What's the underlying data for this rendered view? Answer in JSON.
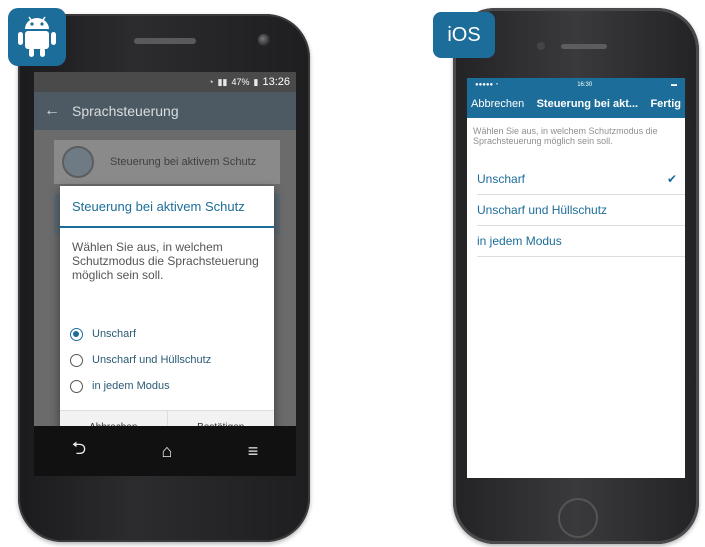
{
  "colors": {
    "brand_blue": "#1c6d99",
    "android_appbar": "#4d5a63",
    "dialog_overlay": "#6b6b6b"
  },
  "android": {
    "platform_icon": "android-robot-icon",
    "status": {
      "battery": "47%",
      "time": "13:26"
    },
    "appbar": {
      "title": "Sprachsteuerung"
    },
    "background_card_label": "Steuerung bei aktivem Schutz",
    "dialog": {
      "title": "Steuerung bei aktivem Schutz",
      "message": "Wählen Sie aus, in welchem Schutzmodus die Sprachsteuerung möglich sein soll.",
      "options": [
        {
          "label": "Unscharf",
          "selected": true
        },
        {
          "label": "Unscharf und Hüllschutz",
          "selected": false
        },
        {
          "label": "in jedem Modus",
          "selected": false
        }
      ],
      "cancel_label": "Abbrechen",
      "confirm_label": "Bestätigen"
    }
  },
  "ios": {
    "platform_label": "iOS",
    "status": {
      "time": "16:30"
    },
    "nav": {
      "back_label": "Abbrechen",
      "title": "Steuerung bei akt...",
      "done_label": "Fertig"
    },
    "description": "Wählen Sie aus, in welchem Schutzmodus die Sprachsteuerung möglich sein soll.",
    "options": [
      {
        "label": "Unscharf",
        "selected": true
      },
      {
        "label": "Unscharf und Hüllschutz",
        "selected": false
      },
      {
        "label": "in jedem Modus",
        "selected": false
      }
    ]
  }
}
